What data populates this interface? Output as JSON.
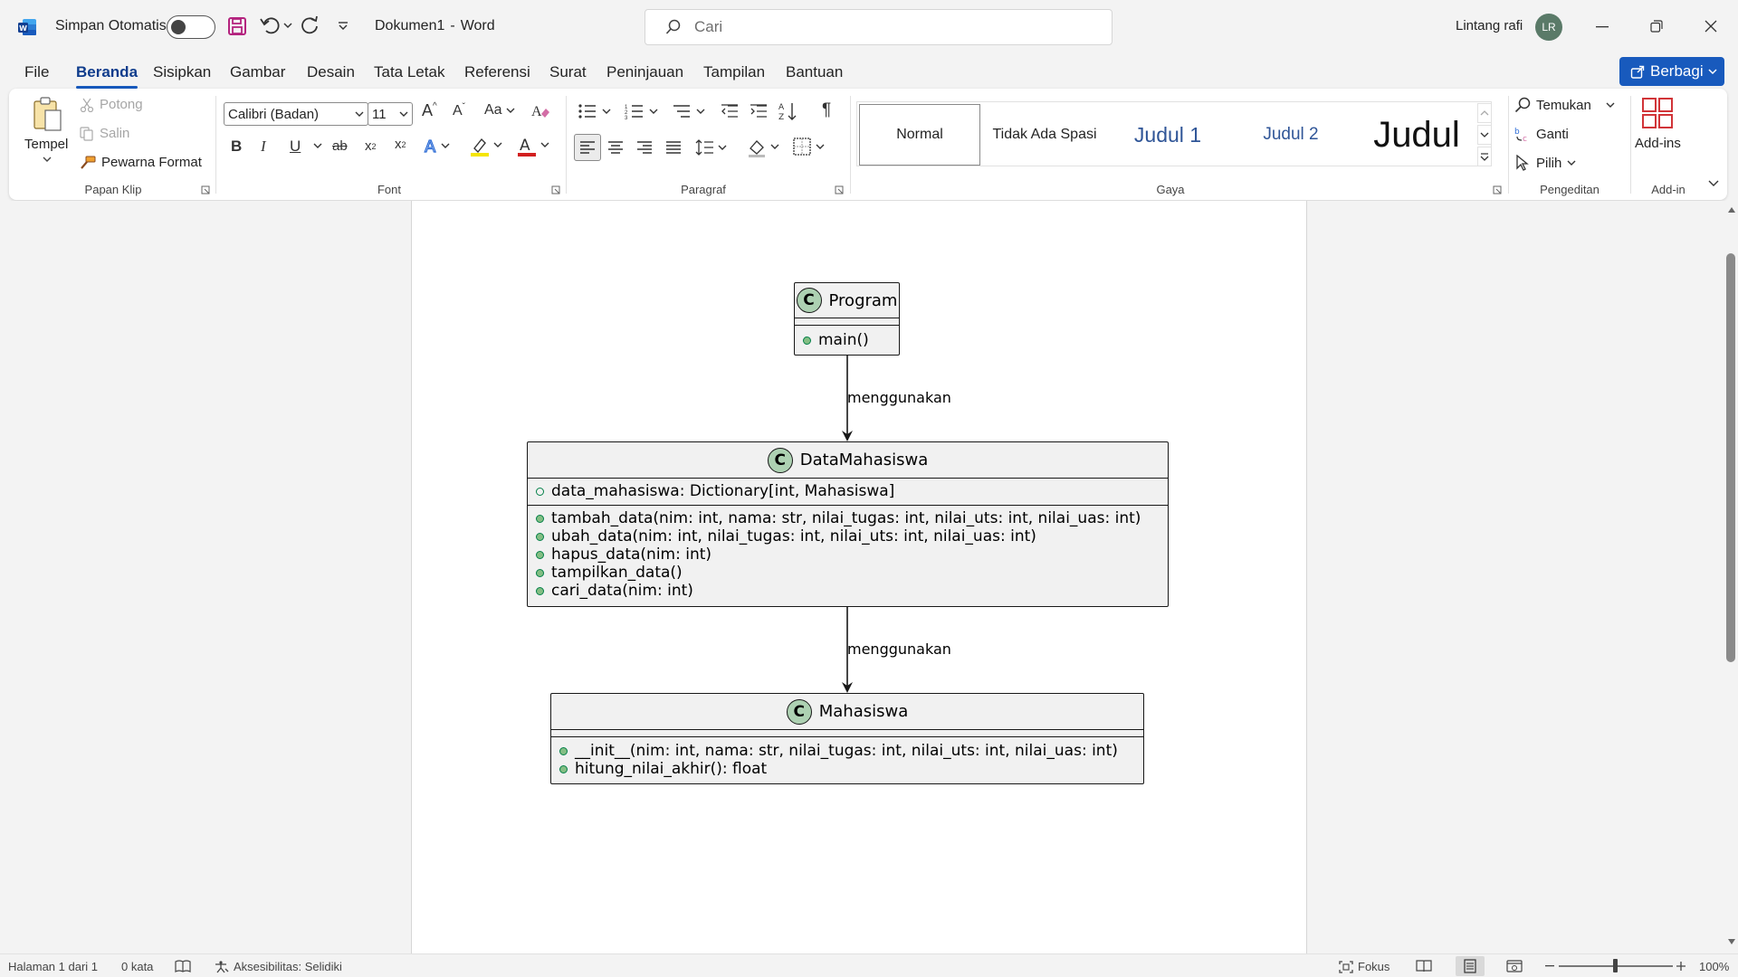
{
  "titlebar": {
    "autosave_label": "Simpan Otomatis",
    "doc_title": "Dokumen1",
    "title_sep": "-",
    "app_name": "Word",
    "search_placeholder": "Cari",
    "user_name": "Lintang rafi",
    "user_initials": "LR"
  },
  "menu": {
    "tabs": [
      "File",
      "Beranda",
      "Sisipkan",
      "Gambar",
      "Desain",
      "Tata Letak",
      "Referensi",
      "Surat",
      "Peninjauan",
      "Tampilan",
      "Bantuan"
    ],
    "active": "Beranda",
    "share_label": "Berbagi"
  },
  "ribbon": {
    "clipboard": {
      "paste": "Tempel",
      "cut": "Potong",
      "copy": "Salin",
      "format_painter": "Pewarna Format",
      "group": "Papan Klip"
    },
    "font": {
      "name": "Calibri (Badan)",
      "size": "11",
      "change_case": "Aa",
      "group": "Font"
    },
    "paragraph": {
      "group": "Paragraf"
    },
    "styles": {
      "items": [
        "Normal",
        "Tidak Ada Spasi",
        "Judul 1",
        "Judul 2",
        "Judul"
      ],
      "group": "Gaya"
    },
    "editing": {
      "find": "Temukan",
      "replace": "Ganti",
      "select": "Pilih",
      "group": "Pengeditan"
    },
    "addins": {
      "label": "Add-ins",
      "group": "Add-in"
    }
  },
  "diagram": {
    "program": {
      "name": "Program",
      "methods": [
        "main()"
      ]
    },
    "edge1_label": "menggunakan",
    "data_mahasiswa": {
      "name": "DataMahasiswa",
      "fields": [
        "data_mahasiswa: Dictionary[int, Mahasiswa]"
      ],
      "methods": [
        "tambah_data(nim: int, nama: str, nilai_tugas: int, nilai_uts: int, nilai_uas: int)",
        "ubah_data(nim: int, nilai_tugas: int, nilai_uts: int, nilai_uas: int)",
        "hapus_data(nim: int)",
        "tampilkan_data()",
        "cari_data(nim: int)"
      ]
    },
    "edge2_label": "menggunakan",
    "mahasiswa": {
      "name": "Mahasiswa",
      "methods": [
        "__init__(nim: int, nama: str, nilai_tugas: int, nilai_uts: int, nilai_uas: int)",
        "hitung_nilai_akhir(): float"
      ]
    },
    "class_badge": "C"
  },
  "status": {
    "page": "Halaman 1 dari 1",
    "words": "0 kata",
    "accessibility": "Aksesibilitas: Selidiki",
    "focus": "Fokus",
    "zoom": "100%"
  }
}
